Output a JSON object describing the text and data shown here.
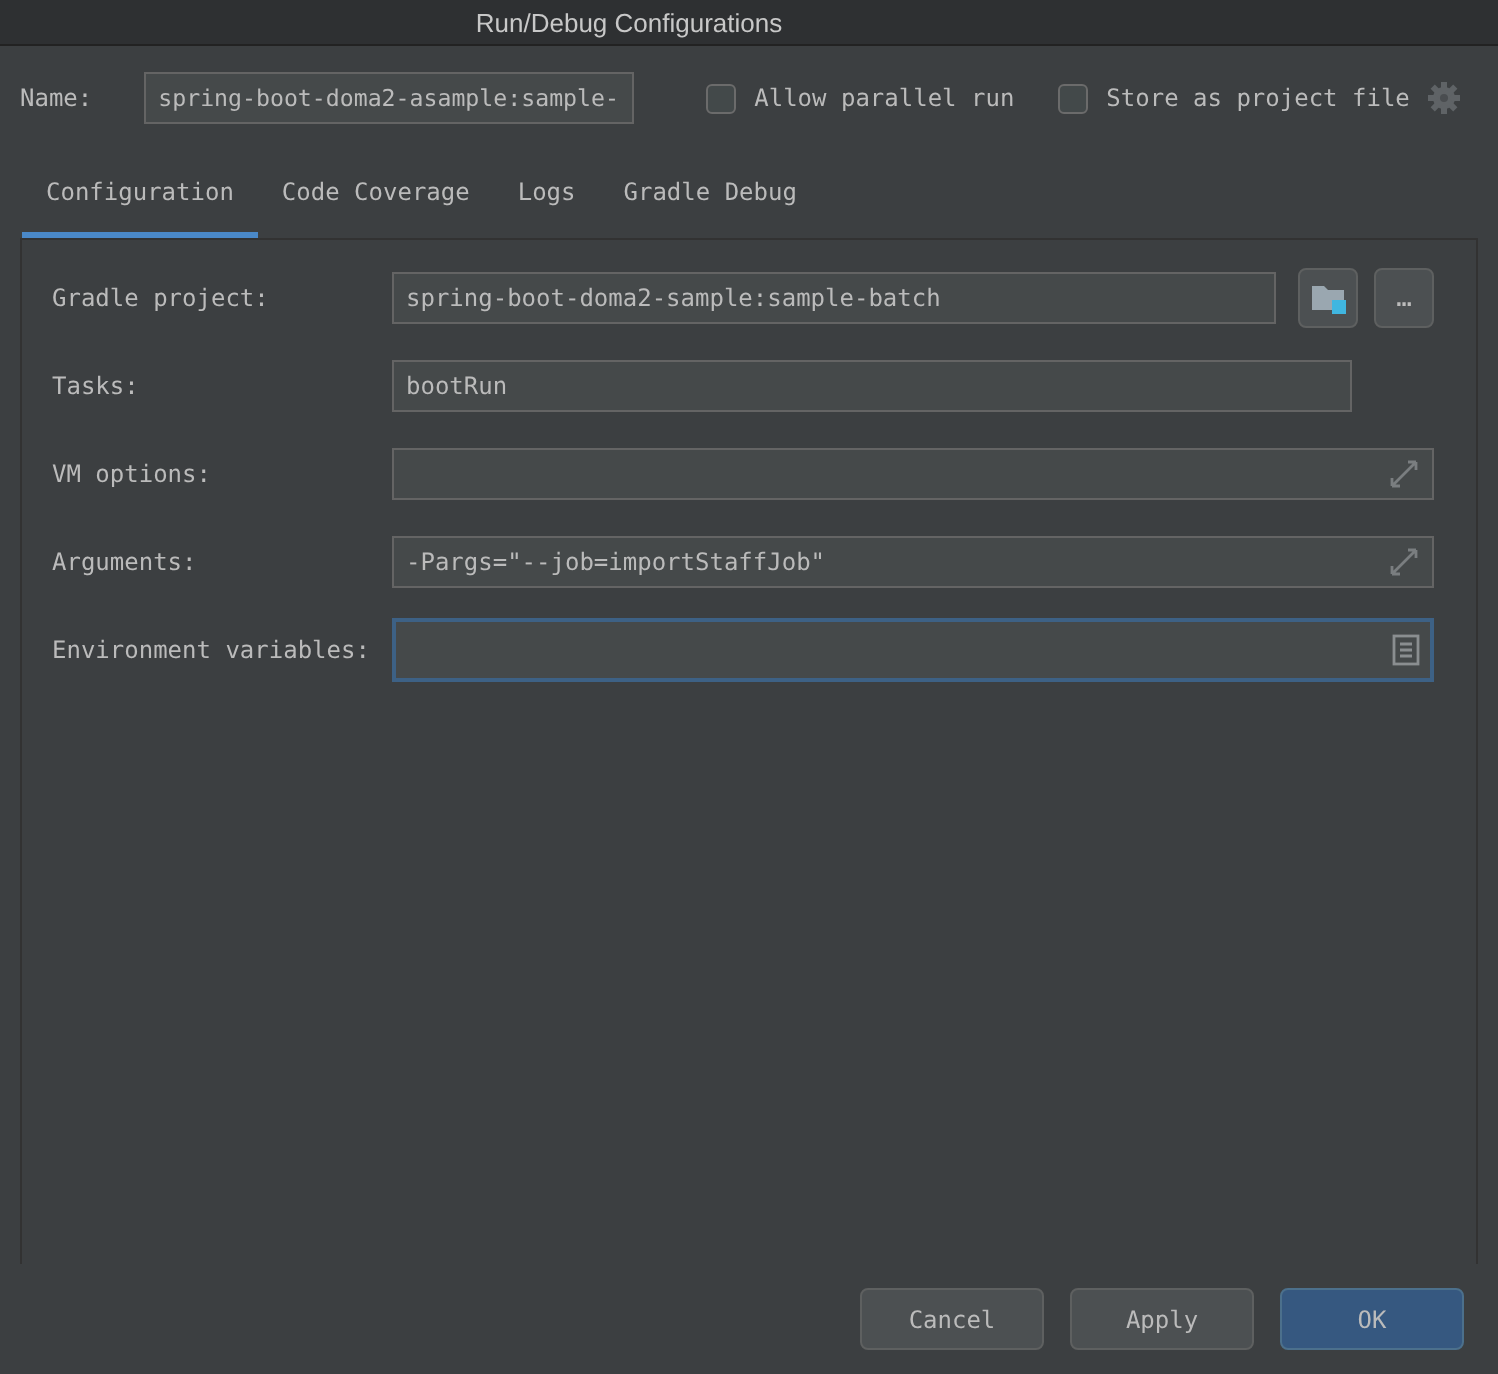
{
  "window": {
    "title": "Run/Debug Configurations"
  },
  "name": {
    "label": "Name:",
    "value": "spring-boot-doma2-asample:sample-"
  },
  "options": [
    {
      "label": "Allow parallel run",
      "checked": false
    },
    {
      "label": "Store as project file",
      "checked": false
    }
  ],
  "tabs": [
    {
      "label": "Configuration",
      "selected": true
    },
    {
      "label": "Code Coverage",
      "selected": false
    },
    {
      "label": "Logs",
      "selected": false
    },
    {
      "label": "Gradle Debug",
      "selected": false
    }
  ],
  "fields": [
    {
      "label": "Gradle project:",
      "value": "spring-boot-doma2-sample:sample-batch",
      "kind": "browse",
      "more": "…",
      "focused": false
    },
    {
      "label": "Tasks:",
      "value": "bootRun",
      "kind": "plain",
      "focused": false
    },
    {
      "label": "VM options:",
      "kind": "expand",
      "focused": false
    },
    {
      "label": "Arguments:",
      "value": "-Pargs=\"--job=importStaffJob\"",
      "kind": "expand",
      "focused": false
    },
    {
      "label": "Environment variables:",
      "kind": "document",
      "focused": true
    }
  ],
  "buttons": [
    {
      "label": "Cancel",
      "default": false
    },
    {
      "label": "Apply",
      "default": false
    },
    {
      "label": "OK",
      "default": true
    }
  ]
}
